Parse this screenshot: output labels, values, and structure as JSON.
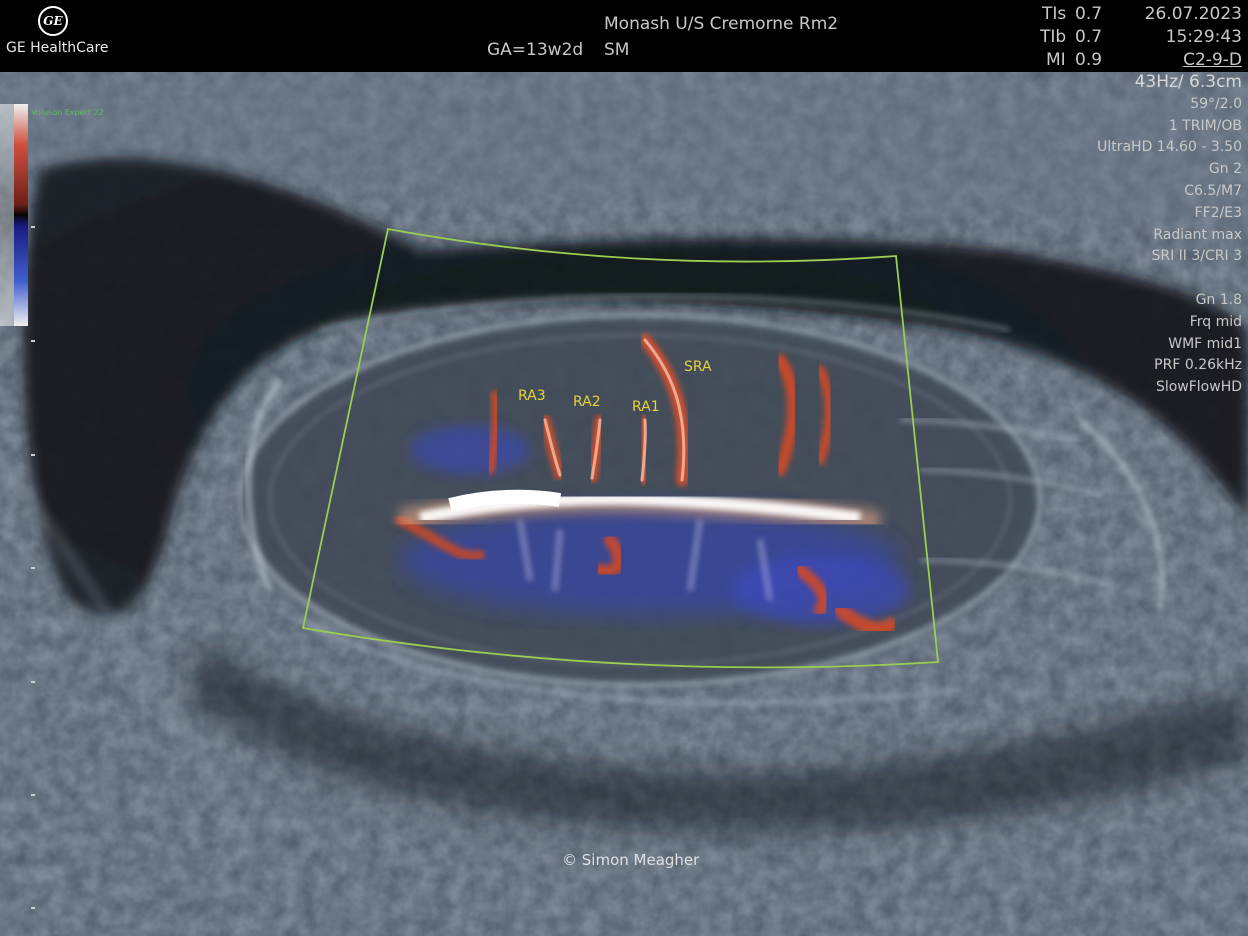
{
  "header": {
    "brand": "GE HealthCare",
    "logo_text": "GE",
    "site": "Monash U/S Cremorne Rm2",
    "operator": "SM",
    "gestational_age": "GA=13w2d",
    "tis_label": "TIs",
    "tis_value": "0.7",
    "tib_label": "TIb",
    "tib_value": "0.7",
    "mi_label": "MI",
    "mi_value": "0.9",
    "date": "26.07.2023",
    "time": "15:29:43",
    "probe": "C2-9-D"
  },
  "imaging_params": [
    "43Hz/ 6.3cm",
    "59°/2.0",
    "1 TRIM/OB",
    "UltraHD 14.60 - 3.50",
    "Gn  2",
    "C6.5/M7",
    "FF2/E3",
    "Radiant max",
    "SRI II 3/CRI 3"
  ],
  "color_params": [
    "Gn  1.8",
    "Frq mid",
    "WMF mid1",
    "PRF 0.26kHz",
    "SlowFlowHD"
  ],
  "device_label": "Voluson Expert 22",
  "annotations": {
    "ra3": "RA3",
    "ra2": "RA2",
    "ra1": "RA1",
    "sra": "SRA"
  },
  "copyright": "© Simon Meagher",
  "colors": {
    "roi_box": "#9acd52",
    "annotation": "#e6d23a",
    "flow_toward": "#e0502a",
    "flow_away": "#3a4acc"
  }
}
